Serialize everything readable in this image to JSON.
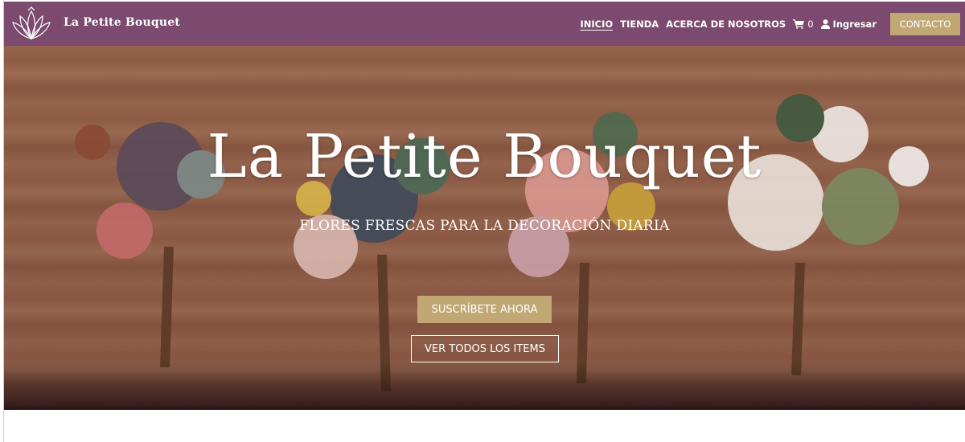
{
  "brand": {
    "name": "La Petite Bouquet"
  },
  "nav": {
    "links": [
      "INICIO",
      "TIENDA",
      "ACERCA DE NOSOTROS"
    ],
    "cart_count": "0",
    "login_label": "Ingresar",
    "contact_label": "CONTACTO"
  },
  "hero": {
    "title": "La Petite Bouquet",
    "subtitle": "FLORES FRESCAS PARA LA DECORACIÓN DIARIA",
    "subscribe_label": "SUSCRÍBETE AHORA",
    "view_all_label": "VER TODOS LOS ITEMS"
  },
  "colors": {
    "navbar": "#7b4a6e",
    "accent": "#c1a774"
  },
  "icons": [
    "lotus-logo-icon",
    "cart-icon",
    "user-icon"
  ]
}
